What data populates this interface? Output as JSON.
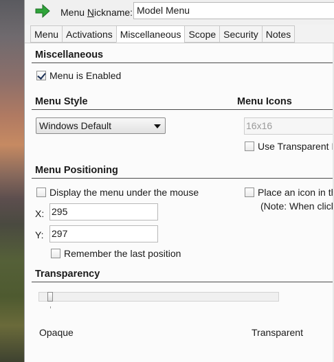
{
  "header": {
    "nickname_label_pre": "Menu ",
    "nickname_label_u": "N",
    "nickname_label_post": "ickname:",
    "nickname_value": "Model Menu"
  },
  "tabs": [
    {
      "label": "Menu"
    },
    {
      "label": "Activations"
    },
    {
      "label": "Miscellaneous"
    },
    {
      "label": "Scope"
    },
    {
      "label": "Security"
    },
    {
      "label": "Notes"
    }
  ],
  "miscellaneous": {
    "title": "Miscellaneous",
    "menu_enabled_label": "Menu is Enabled",
    "menu_enabled_checked": true
  },
  "menu_style": {
    "title": "Menu Style",
    "selected": "Windows Default"
  },
  "menu_icons": {
    "title": "Menu Icons",
    "size_value": "16x16",
    "transparent_label": "Use Transparent Ic"
  },
  "positioning": {
    "title": "Menu Positioning",
    "under_mouse_label": "Display the menu under the mouse",
    "x_label": "X:",
    "x_value": "295",
    "y_label": "Y:",
    "y_value": "297",
    "remember_label": "Remember the last position",
    "place_icon_label": "Place an icon in the",
    "place_icon_note": "(Note: When click"
  },
  "transparency": {
    "title": "Transparency",
    "min_label": "Opaque",
    "max_label": "Transparent",
    "level": 0
  }
}
